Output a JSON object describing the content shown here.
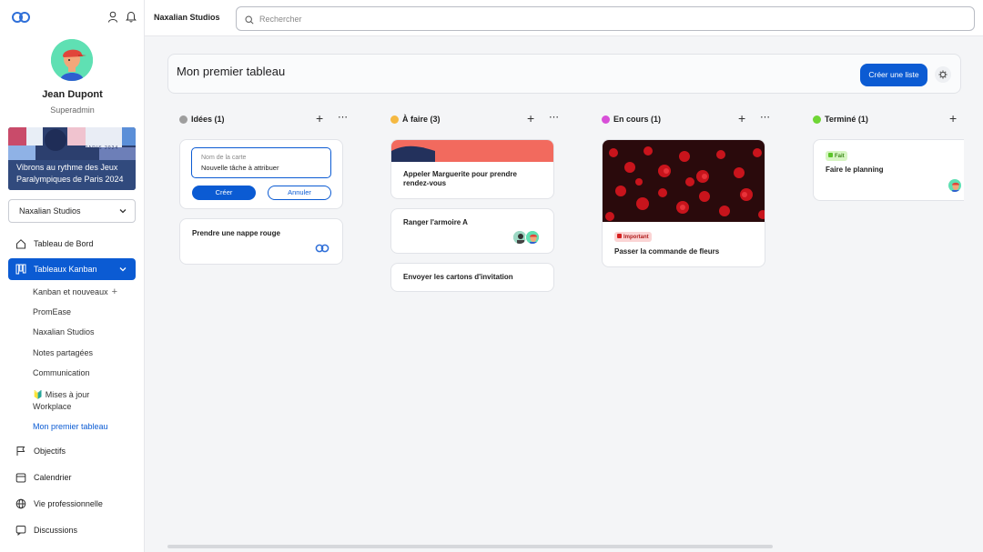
{
  "app": {
    "workspace_name": "Naxalian Studios",
    "search_placeholder": "Rechercher"
  },
  "user": {
    "name": "Jean Dupont",
    "role": "Superadmin"
  },
  "banner": {
    "text": "Vibrons au rythme des Jeux Paralympiques de Paris 2024",
    "tag": "PARIS 2024"
  },
  "org_select": {
    "value": "Naxalian Studios"
  },
  "nav": {
    "dashboard": "Tableau de Bord",
    "kanban": "Tableaux Kanban",
    "objectives": "Objectifs",
    "calendar": "Calendrier",
    "professional_life": "Vie professionnelle",
    "discussions": "Discussions"
  },
  "kanban_boards": [
    {
      "label": "Kanban et nouveaux"
    },
    {
      "label": "PromEase"
    },
    {
      "label": "Naxalian Studios"
    },
    {
      "label": "Notes partagées"
    },
    {
      "label": "Communication"
    },
    {
      "label": "🔰 Mises à jour"
    },
    {
      "label": "Workplace"
    },
    {
      "label": "Mon premier tableau"
    }
  ],
  "board": {
    "title": "Mon premier tableau",
    "create_list_label": "Créer une liste"
  },
  "columns": [
    {
      "title": "Idées (1)",
      "color": "#9e9e9e"
    },
    {
      "title": "À faire (3)",
      "color": "#f5b942"
    },
    {
      "title": "En cours (1)",
      "color": "#d84fd8"
    },
    {
      "title": "Terminé (1)",
      "color": "#6fd635"
    }
  ],
  "new_card_form": {
    "placeholder": "Nom de la carte",
    "value": "Nouvelle tâche à attribuer",
    "create_label": "Créer",
    "cancel_label": "Annuler"
  },
  "cards": {
    "ideas_1": "Prendre une nappe rouge",
    "todo_1": "Appeler Marguerite pour prendre rendez-vous",
    "todo_2": "Ranger l'armoire A",
    "todo_3": "Envoyer les cartons d'invitation",
    "inprogress_1": "Passer la commande de fleurs",
    "inprogress_1_tag": "Important",
    "done_1": "Faire le planning",
    "done_1_tag": "Fait"
  }
}
